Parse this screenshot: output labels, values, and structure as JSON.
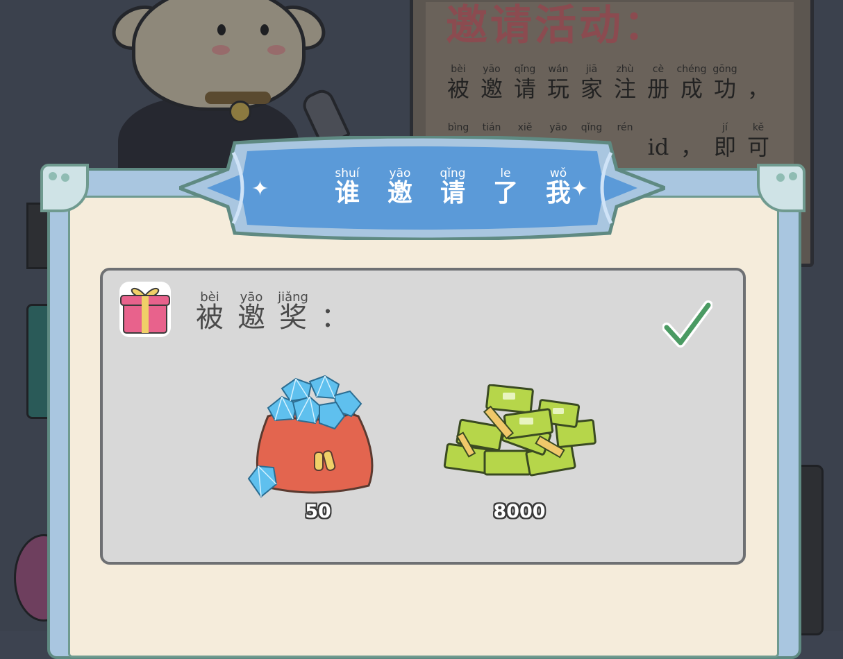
{
  "background": {
    "board_title": "邀请活动：",
    "board_line1": [
      {
        "py": "bèi",
        "hz": "被"
      },
      {
        "py": "yāo",
        "hz": "邀"
      },
      {
        "py": "qǐng",
        "hz": "请"
      },
      {
        "py": "wán",
        "hz": "玩"
      },
      {
        "py": "jiā",
        "hz": "家"
      },
      {
        "py": "zhù",
        "hz": "注"
      },
      {
        "py": "cè",
        "hz": "册"
      },
      {
        "py": "chéng",
        "hz": "成"
      },
      {
        "py": "gōng",
        "hz": "功"
      },
      {
        "py": "",
        "hz": "，"
      }
    ],
    "board_line2": [
      {
        "py": "bìng",
        "hz": ""
      },
      {
        "py": "tián",
        "hz": ""
      },
      {
        "py": "xiě",
        "hz": ""
      },
      {
        "py": "yāo",
        "hz": ""
      },
      {
        "py": "qǐng",
        "hz": ""
      },
      {
        "py": "rén",
        "hz": ""
      },
      {
        "py": "",
        "hz": "id"
      },
      {
        "py": "",
        "hz": "，"
      },
      {
        "py": "jí",
        "hz": "即"
      },
      {
        "py": "kě",
        "hz": "可"
      }
    ]
  },
  "dialog": {
    "title": [
      {
        "py": "shuí",
        "hz": "谁"
      },
      {
        "py": "yāo",
        "hz": "邀"
      },
      {
        "py": "qǐng",
        "hz": "请"
      },
      {
        "py": "le",
        "hz": "了"
      },
      {
        "py": "wǒ",
        "hz": "我"
      }
    ],
    "reward_heading": [
      {
        "py": "bèi",
        "hz": "被"
      },
      {
        "py": "yāo",
        "hz": "邀"
      },
      {
        "py": "jiǎng",
        "hz": "奖"
      },
      {
        "py": "",
        "hz": "："
      }
    ],
    "rewards": [
      {
        "icon": "diamond-bag-icon",
        "amount": "50"
      },
      {
        "icon": "cash-pile-icon",
        "amount": "8000"
      }
    ],
    "claimed_icon": "checkmark-icon"
  },
  "colors": {
    "banner": "#5b9ad8",
    "panel_bg": "#d8d8d8",
    "check": "#4a9a62"
  }
}
